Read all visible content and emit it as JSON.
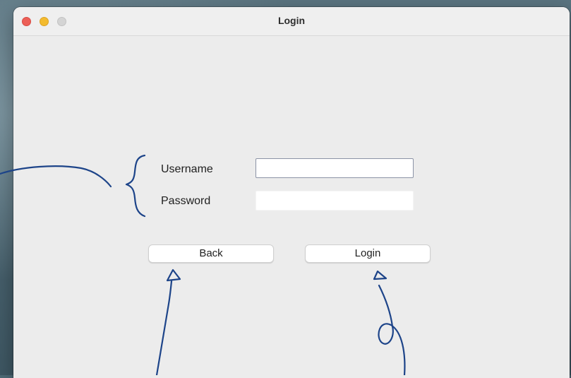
{
  "window": {
    "title": "Login"
  },
  "form": {
    "username_label": "Username",
    "password_label": "Password",
    "username_value": "",
    "password_value": ""
  },
  "buttons": {
    "back_label": "Back",
    "login_label": "Login"
  },
  "icons": {
    "close": "close-button-icon",
    "minimize": "minimize-button-icon",
    "maximize": "maximize-button-icon"
  },
  "colors": {
    "close": "#ec5f57",
    "minimize": "#f3bb2f",
    "maximize": "#d4d4d4",
    "annotation_ink": "#1d4489"
  }
}
